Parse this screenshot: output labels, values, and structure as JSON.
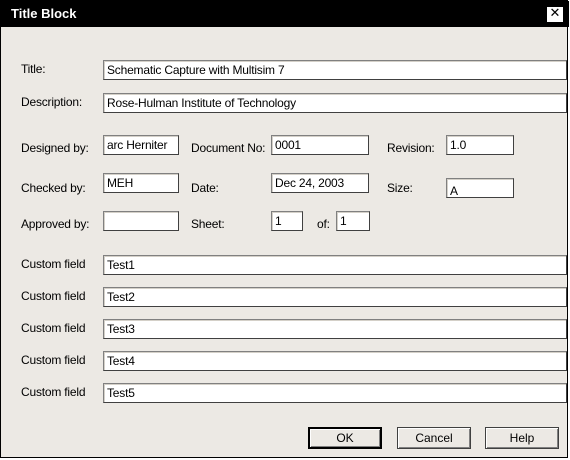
{
  "window": {
    "title": "Title Block",
    "close_glyph": "✕",
    "close_icon": "close-icon"
  },
  "fields": {
    "title": {
      "label": "Title:",
      "value": "Schematic Capture with Multisim 7"
    },
    "description": {
      "label": "Description:",
      "value": "Rose-Hulman Institute of Technology"
    },
    "designed_by": {
      "label": "Designed by:",
      "value": "arc Herniter"
    },
    "document_no": {
      "label": "Document No:",
      "value": "0001"
    },
    "revision": {
      "label": "Revision:",
      "value": "1.0"
    },
    "checked_by": {
      "label": "Checked by:",
      "value": "MEH"
    },
    "date": {
      "label": "Date:",
      "value": "Dec 24, 2003"
    },
    "size": {
      "label": "Size:",
      "value": "A"
    },
    "approved_by": {
      "label": "Approved by:",
      "value": ""
    },
    "sheet": {
      "label": "Sheet:",
      "value": "1"
    },
    "of": {
      "label": "of:",
      "value": "1"
    }
  },
  "custom_fields": [
    {
      "label": "Custom field",
      "value": "Test1"
    },
    {
      "label": "Custom field",
      "value": "Test2"
    },
    {
      "label": "Custom field",
      "value": "Test3"
    },
    {
      "label": "Custom field",
      "value": "Test4"
    },
    {
      "label": "Custom field",
      "value": "Test5"
    }
  ],
  "buttons": {
    "ok": "OK",
    "cancel": "Cancel",
    "help": "Help"
  }
}
